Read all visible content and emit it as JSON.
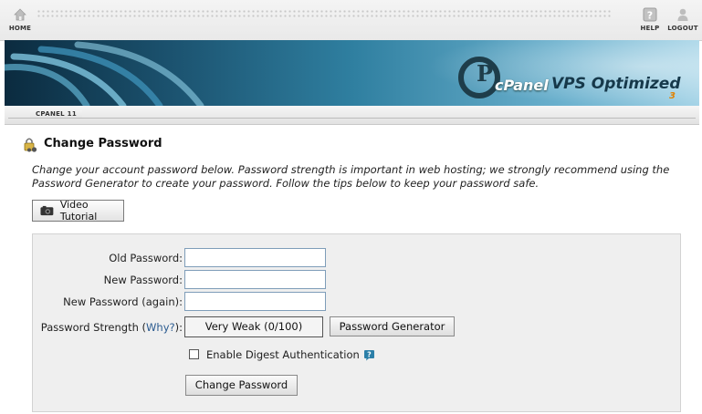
{
  "topnav": {
    "home_label": "HOME",
    "help_label": "HELP",
    "logout_label": "LOGOUT"
  },
  "banner": {
    "brand": "cPanel",
    "brand_suffix": "VPS Optimized",
    "version_mark": "3"
  },
  "breadcrumb": {
    "label": "CPANEL 11"
  },
  "page": {
    "title": "Change Password",
    "intro": "Change your account password below. Password strength is important in web hosting; we strongly recommend using the Password Generator to create your password. Follow the tips below to keep your password safe.",
    "video_button": "Video Tutorial"
  },
  "form": {
    "old_password_label": "Old Password:",
    "old_password_value": "",
    "new_password_label": "New Password:",
    "new_password_value": "",
    "new_password_again_label": "New Password (again):",
    "new_password_again_value": "",
    "strength_label_prefix": "Password Strength (",
    "strength_why_link": "Why?",
    "strength_label_suffix": "):",
    "strength_value": "Very Weak (0/100)",
    "generator_button": "Password Generator",
    "digest_label": "Enable Digest Authentication",
    "digest_checked": false,
    "submit_button": "Change Password"
  },
  "colors": {
    "link": "#2a5a8f",
    "accent_orange": "#e28200",
    "help_icon": "#2b7fa8"
  }
}
